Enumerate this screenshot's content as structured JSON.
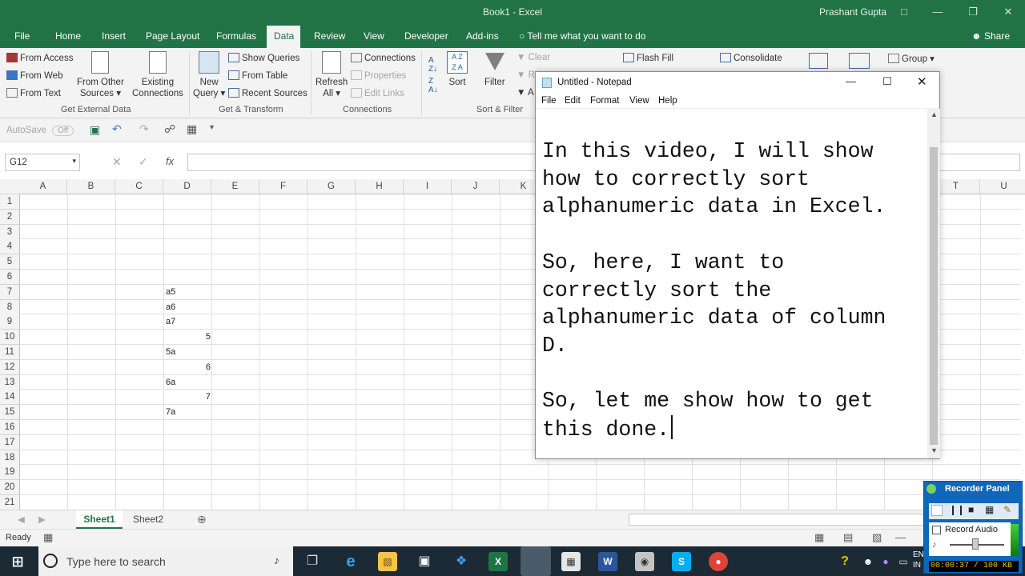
{
  "excel": {
    "title": "Book1  -  Excel",
    "user": "Prashant Gupta",
    "tabs": [
      "File",
      "Home",
      "Insert",
      "Page Layout",
      "Formulas",
      "Data",
      "Review",
      "View",
      "Developer",
      "Add-ins"
    ],
    "active_tab": "Data",
    "tell_me": "Tell me what you want to do",
    "share": "Share",
    "ribbon": {
      "get_external_data": {
        "group": "Get External Data",
        "from_access": "From Access",
        "from_web": "From Web",
        "from_text": "From Text",
        "from_other_sources_1": "From Other",
        "from_other_sources_2": "Sources",
        "existing_connections_1": "Existing",
        "existing_connections_2": "Connections"
      },
      "get_transform": {
        "group": "Get & Transform",
        "new_query_1": "New",
        "new_query_2": "Query",
        "show_queries": "Show Queries",
        "from_table": "From Table",
        "recent_sources": "Recent Sources"
      },
      "connections": {
        "group": "Connections",
        "refresh_all_1": "Refresh",
        "refresh_all_2": "All",
        "connections": "Connections",
        "properties": "Properties",
        "edit_links": "Edit Links"
      },
      "sort_filter": {
        "group": "Sort & Filter",
        "sort": "Sort",
        "filter": "Filter",
        "clear": "Clear",
        "reapply": "R",
        "advanced": "A"
      },
      "data_tools": {
        "flash_fill": "Flash Fill",
        "consolidate": "Consolidate",
        "group": "Group"
      }
    },
    "qat": {
      "autosave": "AutoSave",
      "autosave_state": "Off"
    },
    "name_box": "G12",
    "formula": "",
    "columns": [
      "A",
      "B",
      "C",
      "D",
      "E",
      "F",
      "G",
      "H",
      "I",
      "J",
      "K",
      "L",
      "M",
      "N",
      "O",
      "P",
      "Q",
      "R",
      "S",
      "T",
      "U"
    ],
    "rows": [
      "1",
      "2",
      "3",
      "4",
      "5",
      "6",
      "7",
      "8",
      "9",
      "10",
      "11",
      "12",
      "13",
      "14",
      "15",
      "16",
      "17",
      "18",
      "19",
      "20",
      "21"
    ],
    "cells": [
      {
        "ref": "D7",
        "value": "a5",
        "align": "left"
      },
      {
        "ref": "D8",
        "value": "a6",
        "align": "left"
      },
      {
        "ref": "D9",
        "value": "a7",
        "align": "left"
      },
      {
        "ref": "D10",
        "value": "5",
        "align": "right"
      },
      {
        "ref": "D11",
        "value": "5a",
        "align": "left"
      },
      {
        "ref": "D12",
        "value": "6",
        "align": "right"
      },
      {
        "ref": "D13",
        "value": "6a",
        "align": "left"
      },
      {
        "ref": "D14",
        "value": "7",
        "align": "right"
      },
      {
        "ref": "D15",
        "value": "7a",
        "align": "left"
      }
    ],
    "sheets": [
      "Sheet1",
      "Sheet2"
    ],
    "active_sheet": "Sheet1",
    "status": "Ready"
  },
  "notepad": {
    "title": "Untitled - Notepad",
    "menu": [
      "File",
      "Edit",
      "Format",
      "View",
      "Help"
    ],
    "text": "In this video, I will show\nhow to correctly sort\nalphanumeric data in Excel.\n\nSo, here, I want to\ncorrectly sort the\nalphanumeric data of column\nD.\n\nSo, let me show how to get\nthis done."
  },
  "taskbar": {
    "search_placeholder": "Type here to search",
    "lang": "EN",
    "lang2": "IN"
  },
  "recorder": {
    "title": "Recorder Panel",
    "record_audio": "Record Audio",
    "time": "00:00:37 / 100 KB"
  },
  "colors": {
    "excel_green": "#217346",
    "taskbar": "#1b2a35",
    "recorder_blue": "#0f67b9"
  }
}
